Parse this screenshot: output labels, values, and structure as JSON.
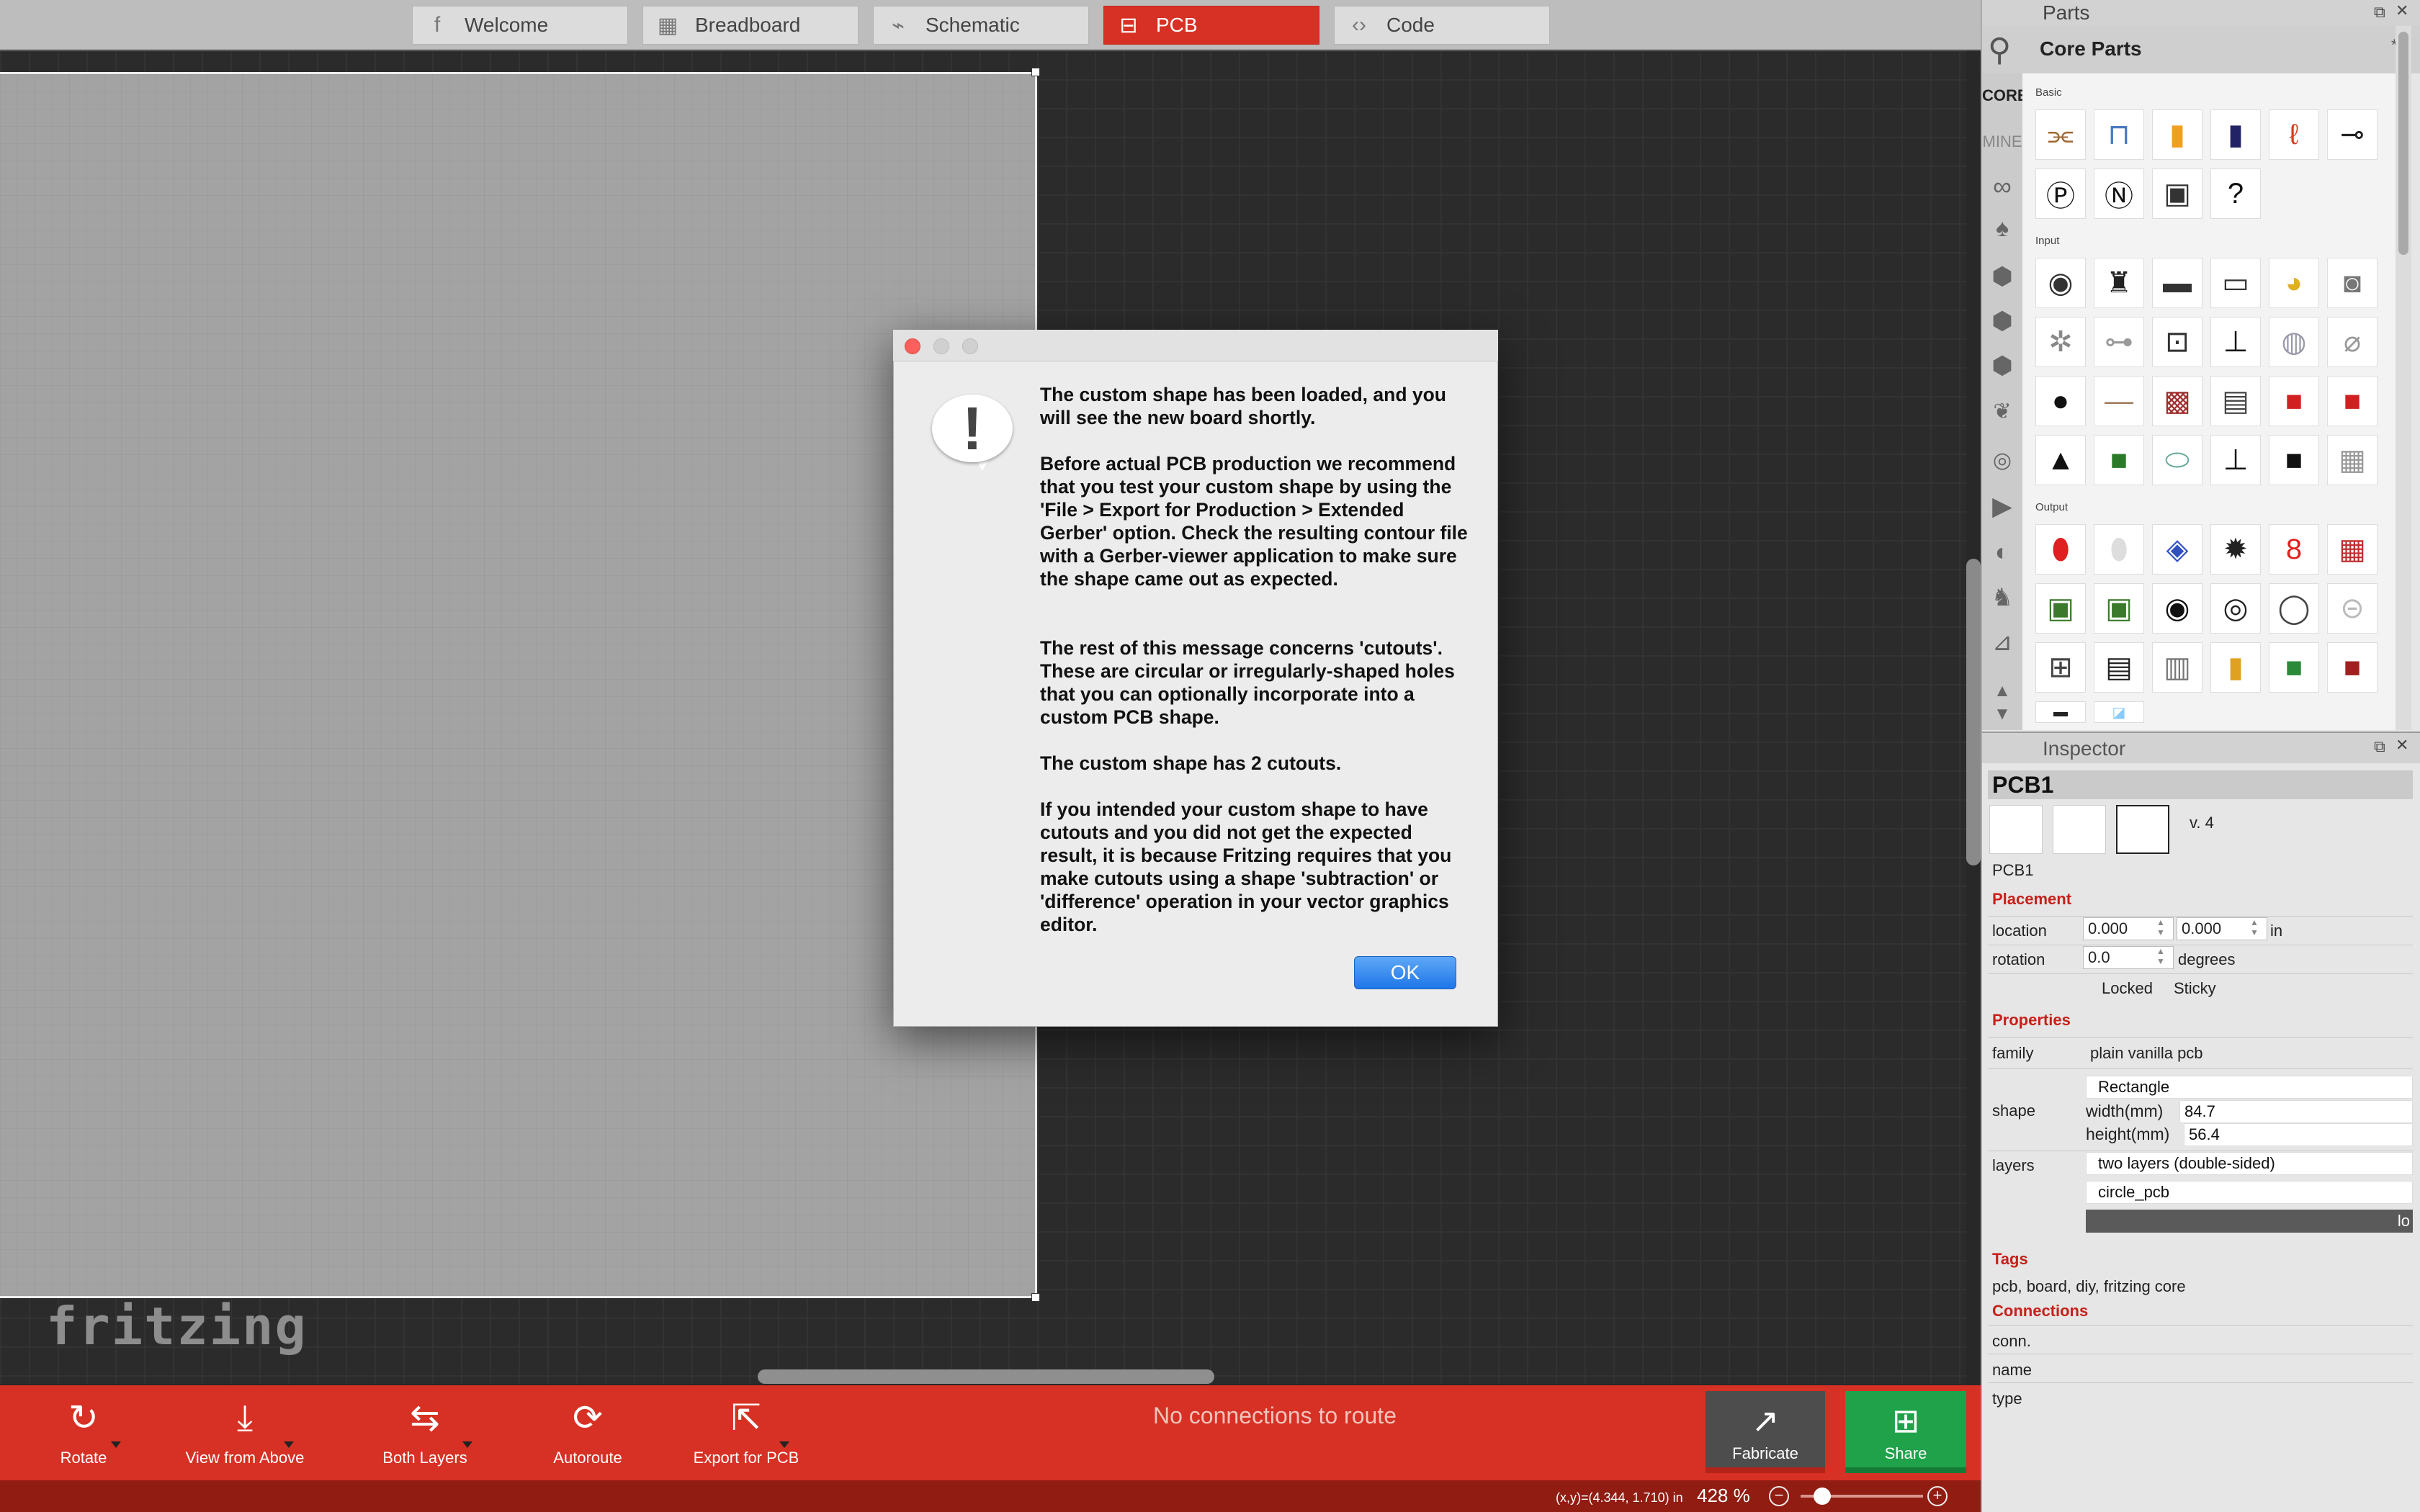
{
  "tabs": [
    {
      "label": "Welcome",
      "icon": "fritzing-f-icon",
      "glyph": "f"
    },
    {
      "label": "Breadboard",
      "icon": "breadboard-icon",
      "glyph": "▦"
    },
    {
      "label": "Schematic",
      "icon": "resistor-symbol-icon",
      "glyph": "⌁"
    },
    {
      "label": "PCB",
      "icon": "pcb-icon",
      "glyph": "⊟",
      "active": true
    },
    {
      "label": "Code",
      "icon": "code-brackets-icon",
      "glyph": "‹›"
    }
  ],
  "canvas": {
    "logo": "fritzing"
  },
  "toolbar": {
    "rotate": "Rotate",
    "view": "View from Above",
    "layers": "Both Layers",
    "autoroute": "Autoroute",
    "export": "Export for PCB",
    "status": "No connections to route",
    "fabricate": "Fabricate",
    "share": "Share"
  },
  "statusbar": {
    "coords": "(x,y)=(4.344, 1.710) in",
    "zoom": "428 %"
  },
  "parts": {
    "panel_title": "Parts",
    "bin_title": "Core Parts",
    "bins": [
      "CORE",
      "MINE"
    ],
    "sections": {
      "basic": "Basic",
      "input": "Input",
      "output": "Output"
    }
  },
  "inspector": {
    "panel_title": "Inspector",
    "title": "PCB1",
    "version": "v. 4",
    "name": "PCB1",
    "placement": "Placement",
    "location_label": "location",
    "loc_x": "0.000",
    "loc_y": "0.000",
    "unit": "in",
    "rotation_label": "rotation",
    "rotation": "0.0",
    "degrees": "degrees",
    "locked": "Locked",
    "sticky": "Sticky",
    "properties": "Properties",
    "family_label": "family",
    "family": "plain vanilla pcb",
    "shape_label": "shape",
    "shape": "Rectangle",
    "width_label": "width(mm)",
    "width": "84.7",
    "height_label": "height(mm)",
    "height": "56.4",
    "layers_label": "layers",
    "layers": "two layers (double-sided)",
    "custom": "circle_pcb",
    "load_btn": "lo",
    "tags": "Tags",
    "tags_value": "pcb, board, diy, fritzing core",
    "connections": "Connections",
    "conn": "conn.",
    "cname": "name",
    "ctype": "type"
  },
  "dialog": {
    "p1": "The custom shape has been loaded, and you will see the new board shortly.",
    "p2": "Before actual PCB production we recommend that you test your custom shape by using the 'File > Export for Production > Extended Gerber' option. Check the resulting contour file with a Gerber-viewer application to make sure the shape came out as expected.",
    "p3": "The rest of this message concerns 'cutouts'. These are circular or irregularly-shaped holes that you can optionally incorporate into a custom PCB shape.",
    "p4": "The custom shape has 2 cutouts.",
    "p5": "If you intended your custom shape to have cutouts and you did not get the expected result, it is because Fritzing requires that you make cutouts using a shape 'subtraction' or 'difference' operation in your vector graphics editor.",
    "ok": "OK"
  },
  "colors": {
    "accent": "#d63124",
    "share": "#1fa24a",
    "ok": "#1e76e8"
  }
}
